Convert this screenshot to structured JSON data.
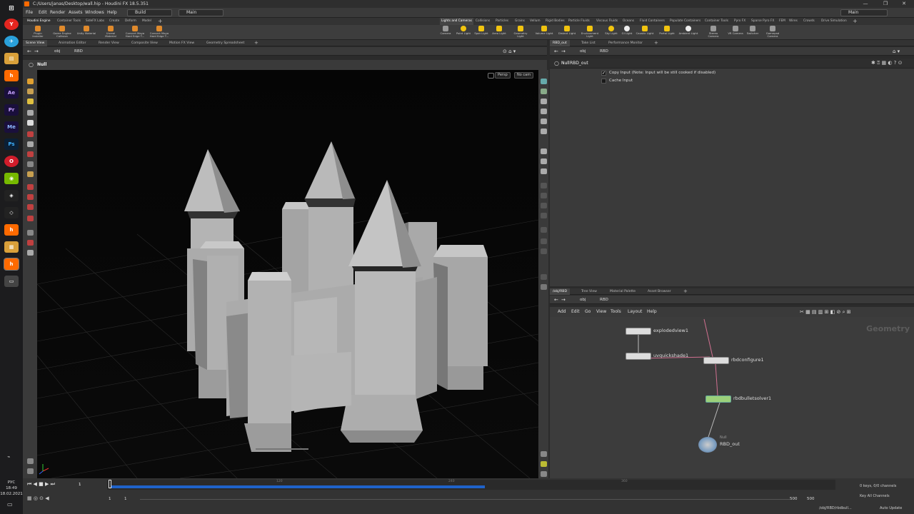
{
  "window": {
    "title": "C:/Users/janas/Desktop/wall.hip - Houdini FX 18.5.351"
  },
  "menu": {
    "items": [
      "File",
      "Edit",
      "Render",
      "Assets",
      "Windows",
      "Help"
    ],
    "desktop": "Build",
    "context": "Main",
    "right_context": "Main"
  },
  "shelf_tabs_left": [
    "Houdini Engine",
    "Container Tools",
    "SideFX Labs",
    "Create",
    "Deform",
    "Model"
  ],
  "shelf_tabs_right": [
    "Lights and Cameras",
    "Collisions",
    "Particles",
    "Grains",
    "Vellum",
    "Rigid Bodies",
    "Particle Fluids",
    "Viscous Fluids",
    "Oceans",
    "Fluid Containers",
    "Populate Containers",
    "Container Tools",
    "Pyro FX",
    "Sparse Pyro FX",
    "FEM",
    "Wires",
    "Crowds",
    "Drive Simulation"
  ],
  "tools_left": [
    "Plugin Installer",
    "Game Engine Collision",
    "Unity Material",
    "Unreal Material",
    "Convert Maya Hard Edge T...",
    "Convert Maya Hard Edge T..."
  ],
  "tools_right": [
    "Camera",
    "Point Light",
    "Spot Light",
    "Area Light",
    "Geometry Light",
    "Volume Light",
    "Distant Light",
    "Environment Light",
    "Sky Light",
    "GI Light",
    "Caustic Light",
    "Portal Light",
    "Ambient Light",
    "Stereo Camera",
    "VR Camera",
    "Switcher",
    "Gamepad Camera"
  ],
  "left_tabs": [
    "Scene View",
    "Animation Editor",
    "Render View",
    "Composite View",
    "Motion FX View",
    "Geometry Spreadsheet"
  ],
  "left_path": {
    "root": "obj",
    "node": "RBD"
  },
  "viewport": {
    "node_label": "Null",
    "persp": "Persp",
    "cam": "No cam"
  },
  "right_top_tabs": [
    "RBD_out",
    "Take List",
    "Performance Monitor"
  ],
  "right_top_path": {
    "root": "obj",
    "node": "RBD"
  },
  "params": {
    "type": "Null",
    "name": "RBD_out",
    "copy_input": "Copy Input (Note: Input will be still cooked if disabled)",
    "cache_input": "Cache Input"
  },
  "net_tabs": [
    "/obj/RBD",
    "Tree View",
    "Material Palette",
    "Asset Browser"
  ],
  "net_path": {
    "root": "obj",
    "node": "RBD"
  },
  "net_menu": [
    "Add",
    "Edit",
    "Go",
    "View",
    "Tools",
    "Layout",
    "Help"
  ],
  "network": {
    "context_label": "Geometry",
    "nodes": [
      {
        "name": "explodedview1"
      },
      {
        "name": "uvquickshade1"
      },
      {
        "name": "rbdconfigure1"
      },
      {
        "name": "rbdbulletsolver1"
      },
      {
        "name": "RBD_out",
        "type": "Null"
      }
    ]
  },
  "timeline": {
    "frame": "1",
    "ticks": [
      "120",
      "240",
      "360"
    ],
    "start": "1",
    "start2": "1",
    "end": "500",
    "end2": "500",
    "keys": "0 keys, 0/0 channels",
    "key_all": "Key All Channels",
    "auto_update": "Auto Update",
    "status_path": "/obj/RBD/rbdbull..."
  },
  "taskbar": {
    "time": "18:49",
    "date": "18.02.2021",
    "lang": "РУС",
    "icons": [
      "Yandex",
      "Telegram",
      "Explorer",
      "Houdini",
      "After Effects",
      "Premiere",
      "Media Encoder",
      "Photoshop",
      "Opera",
      "Nvidia",
      "Unity",
      "Unity Hub",
      "Houdini",
      "Files",
      "Houdini",
      "Other"
    ]
  }
}
